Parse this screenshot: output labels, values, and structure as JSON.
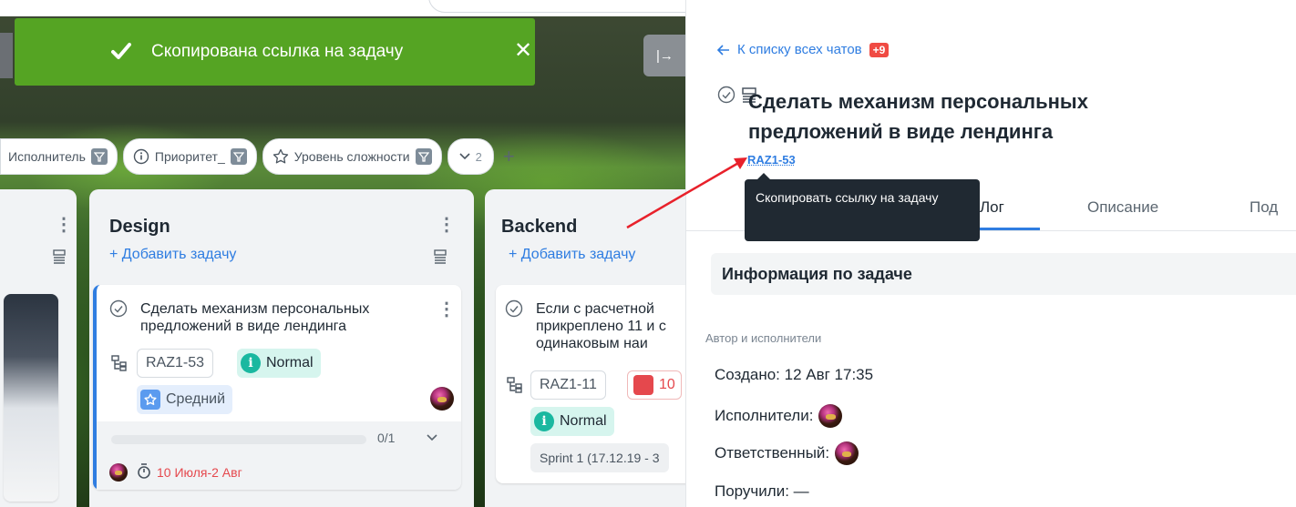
{
  "toast": {
    "message": "Скопирована ссылка на задачу",
    "close": "✕"
  },
  "collapse_button": {
    "label": "|→"
  },
  "filters": [
    {
      "label": "Исполнитель"
    },
    {
      "label": "Приоритет_"
    },
    {
      "label": "Уровень сложности"
    }
  ],
  "filter_more": {
    "count": "2"
  },
  "columns": {
    "design": {
      "title": "Design",
      "add_task": "+ Добавить задачу",
      "card": {
        "title": "Сделать механизм персональных предложений в виде лендинга",
        "code": "RAZ1-53",
        "priority": "Normal",
        "complexity": "Средний",
        "progress": "0/1",
        "progress_fraction": 0,
        "dates": "10 Июля-2 Авг"
      }
    },
    "backend": {
      "title": "Backend",
      "add_task": "+ Добавить задачу",
      "card": {
        "title": "Если с расчетной прикреплено 11 и с одинаковым наи",
        "code": "RAZ1-11",
        "due": "10",
        "priority": "Normal",
        "sprint": "Sprint 1 (17.12.19 - 3"
      }
    }
  },
  "panel": {
    "back_link": "К списку всех чатов",
    "back_badge": "+9",
    "task_title": "Сделать механизм персональных предложений в виде лендинга",
    "task_code": "RAZ1-53",
    "tooltip": "Скопировать ссылку на задачу",
    "tabs": {
      "log": "Лог",
      "description": "Описание",
      "sub": "Под"
    },
    "info_title": "Информация по задаче",
    "authors_label": "Автор и исполнители",
    "created": "Создано:  12 Авг 17:35",
    "assignees": "Исполнители:",
    "responsible": "Ответственный:",
    "assigned_by": "Поручили: —"
  },
  "colors": {
    "accent": "#2f7de1",
    "toast": "#55a423",
    "danger": "#e5484d",
    "arrow": "#e8212b"
  }
}
